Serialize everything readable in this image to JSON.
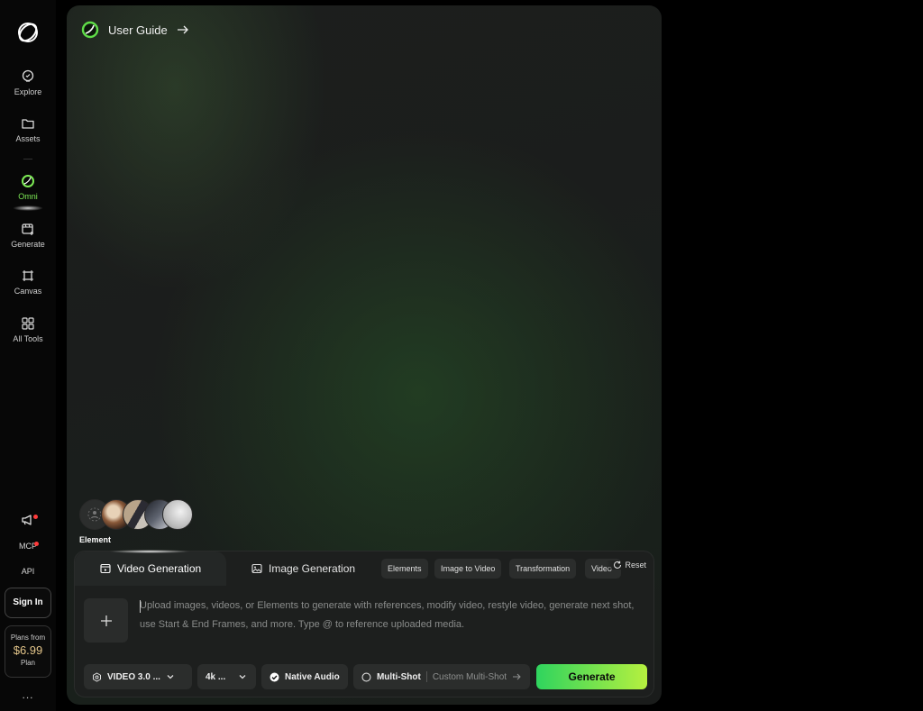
{
  "sidebar": {
    "items": [
      {
        "label": "Explore",
        "icon": "explore-icon"
      },
      {
        "label": "Assets",
        "icon": "folder-icon"
      },
      {
        "label": "Omni",
        "icon": "omni-icon"
      },
      {
        "label": "Generate",
        "icon": "generate-icon"
      },
      {
        "label": "Canvas",
        "icon": "canvas-icon"
      },
      {
        "label": "All Tools",
        "icon": "grid-icon"
      }
    ],
    "mcp_label": "MCP",
    "api_label": "API",
    "signin_label": "Sign In",
    "plan": {
      "line1": "Plans from",
      "price": "$6.99",
      "line3": "Plan"
    },
    "more_label": "..."
  },
  "main": {
    "guide_label": "User Guide",
    "element_label": "Element"
  },
  "composer": {
    "tabs": [
      {
        "label": "Video Generation",
        "active": true
      },
      {
        "label": "Image Generation",
        "active": false
      }
    ],
    "chips": [
      "Elements",
      "Image to Video",
      "Transformation",
      "Video"
    ],
    "reset_label": "Reset",
    "prompt_placeholder": "Upload images, videos, or Elements to generate with references, modify video, restyle video, generate next shot, use Start & End Frames, and more. Type @ to reference uploaded media.",
    "model_label": "VIDEO 3.0 ...",
    "resolution_label": "4k ...",
    "audio_label": "Native Audio",
    "multishot_label": "Multi-Shot",
    "custom_multishot_label": "Custom Multi-Shot",
    "generate_label": "Generate"
  },
  "colors": {
    "accent_green": "#7dea55",
    "generate_start": "#2fd45e",
    "generate_end": "#b6f03f",
    "price": "#e3c58a"
  }
}
